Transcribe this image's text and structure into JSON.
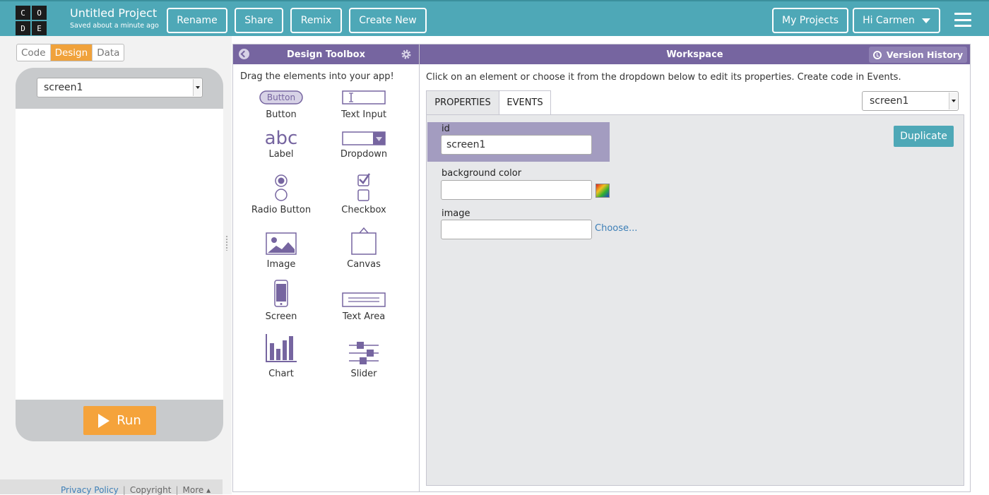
{
  "header": {
    "logo_letters": [
      "C",
      "O",
      "D",
      "E"
    ],
    "project_title": "Untitled Project",
    "saved_status": "Saved about a minute ago",
    "rename_label": "Rename",
    "share_label": "Share",
    "remix_label": "Remix",
    "create_new_label": "Create New",
    "my_projects_label": "My Projects",
    "user_greeting": "Hi Carmen",
    "accent_color": "#4ea8b7"
  },
  "app_pane": {
    "modes": [
      "Code",
      "Design",
      "Data"
    ],
    "active_mode": "Design",
    "screen_select_value": "screen1",
    "run_label": "Run"
  },
  "footer": {
    "links": [
      "Privacy Policy",
      "Copyright",
      "More"
    ]
  },
  "toolbox": {
    "title": "Design Toolbox",
    "hint": "Drag the elements into your app!",
    "button_preview_text": "Button",
    "label_preview_text": "abc",
    "items": [
      {
        "label": "Button",
        "icon": "button-icon"
      },
      {
        "label": "Text Input",
        "icon": "text-input-icon"
      },
      {
        "label": "Label",
        "icon": "label-icon"
      },
      {
        "label": "Dropdown",
        "icon": "dropdown-icon"
      },
      {
        "label": "Radio Button",
        "icon": "radio-button-icon"
      },
      {
        "label": "Checkbox",
        "icon": "checkbox-icon"
      },
      {
        "label": "Image",
        "icon": "image-icon"
      },
      {
        "label": "Canvas",
        "icon": "canvas-icon"
      },
      {
        "label": "Screen",
        "icon": "screen-icon"
      },
      {
        "label": "Text Area",
        "icon": "text-area-icon"
      },
      {
        "label": "Chart",
        "icon": "chart-icon"
      },
      {
        "label": "Slider",
        "icon": "slider-icon"
      }
    ]
  },
  "workspace": {
    "title": "Workspace",
    "version_history_label": "Version History",
    "hint": "Click on an element or choose it from the dropdown below to edit its properties. Create code in Events.",
    "tabs": [
      "PROPERTIES",
      "EVENTS"
    ],
    "active_tab": "PROPERTIES",
    "element_select_value": "screen1",
    "duplicate_label": "Duplicate",
    "properties": {
      "id_label": "id",
      "id_value": "screen1",
      "background_color_label": "background color",
      "background_color_value": "",
      "image_label": "image",
      "image_value": "",
      "choose_label": "Choose..."
    }
  }
}
